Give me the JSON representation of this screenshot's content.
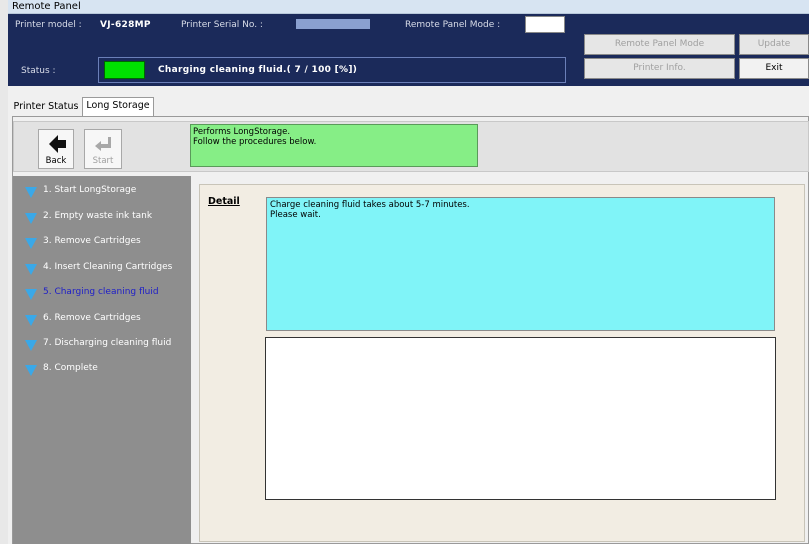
{
  "window": {
    "title": "Remote Panel"
  },
  "header": {
    "printer_model_label": "Printer model :",
    "printer_model_value": "VJ-628MP",
    "serial_label": "Printer Serial No. :",
    "mode_label": "Remote Panel Mode :",
    "status_label": "Status :",
    "status_text": "Charging cleaning fluid.( 7 / 100 [%])",
    "status_led_color": "#00e000",
    "buttons": {
      "remote_panel_mode": "Remote Panel Mode",
      "update": "Update",
      "printer_info": "Printer Info.",
      "exit": "Exit"
    }
  },
  "tabs": [
    {
      "label": "Printer Status",
      "active": false
    },
    {
      "label": "Long Storage",
      "active": true
    }
  ],
  "toolbar": {
    "back_label": "Back",
    "start_label": "Start",
    "info_lines": [
      "Performs LongStorage.",
      "Follow the procedures below."
    ]
  },
  "steps": [
    {
      "label": "1. Start LongStorage",
      "current": false
    },
    {
      "label": "2. Empty waste ink tank",
      "current": false
    },
    {
      "label": "3. Remove Cartridges",
      "current": false
    },
    {
      "label": "4. Insert Cleaning Cartridges",
      "current": false
    },
    {
      "label": "5. Charging cleaning fluid",
      "current": true
    },
    {
      "label": "6. Remove Cartridges",
      "current": false
    },
    {
      "label": "7. Discharging cleaning fluid",
      "current": false
    },
    {
      "label": "8. Complete",
      "current": false
    }
  ],
  "detail": {
    "label": "Detail",
    "lines": [
      "Charge cleaning fluid takes about 5-7 minutes.",
      "Please wait."
    ]
  },
  "colors": {
    "header_bg": "#1b2a5a",
    "sidebar_bg": "#8e8e8e",
    "step_icon": "#3aa8e8",
    "current_step_text": "#1e1ec8",
    "detail_bg": "#80f4f8",
    "info_bg": "#86ee86"
  },
  "icons": {
    "back": "left-arrow-icon",
    "start": "enter-arrow-icon",
    "step": "triangle-down-icon"
  }
}
